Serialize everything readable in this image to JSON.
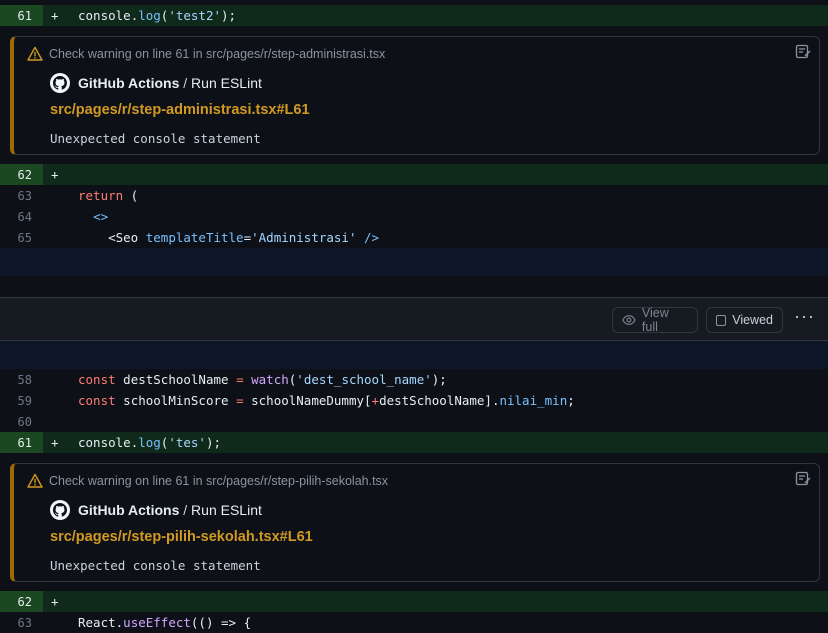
{
  "diff_top": {
    "line_61": {
      "num": "61",
      "marker": "+",
      "code_obj": "console",
      "code_fn": "log",
      "code_str": "'test2'",
      "code_end": ");"
    },
    "line_62": {
      "num": "62",
      "marker": "+"
    },
    "line_63": {
      "num": "63",
      "code_kw": "return",
      "code_rest": " ("
    },
    "line_64": {
      "num": "64",
      "code": "<>"
    },
    "line_65": {
      "num": "65",
      "code_tag": "<Seo",
      "code_attr": "templateTitle",
      "code_eq": "=",
      "code_str": "'Administrasi'",
      "code_close": " />"
    }
  },
  "annotation_1": {
    "title": "Check warning on line 61 in src/pages/r/step-administrasi.tsx",
    "app_name": "GitHub Actions",
    "separator": " / ",
    "job": "Run ESLint",
    "link": "src/pages/r/step-administrasi.tsx#L61",
    "message": "Unexpected console statement"
  },
  "file_header": {
    "view_full_label": "View full",
    "viewed_label": "Viewed"
  },
  "diff_bottom": {
    "line_58": {
      "num": "58",
      "kw": "const",
      "name": " destSchoolName ",
      "eq": "=",
      "sp": " ",
      "fn": "watch",
      "open": "(",
      "str": "'dest_school_name'",
      "end": ");"
    },
    "line_59": {
      "num": "59",
      "kw": "const",
      "name": " schoolMinScore ",
      "eq": "=",
      "rest1": " schoolNameDummy[",
      "op": "+",
      "rest2": "destSchoolName].",
      "prop": "nilai_min",
      "end": ";"
    },
    "line_60": {
      "num": "60"
    },
    "line_61": {
      "num": "61",
      "marker": "+",
      "code_obj": "console",
      "code_fn": "log",
      "code_str": "'tes'",
      "code_end": ");"
    },
    "line_62": {
      "num": "62",
      "marker": "+"
    },
    "line_63": {
      "num": "63",
      "code_obj": "React",
      "code_fn": "useEffect",
      "code_rest": "(() => {"
    }
  },
  "annotation_2": {
    "title": "Check warning on line 61 in src/pages/r/step-pilih-sekolah.tsx",
    "app_name": "GitHub Actions",
    "separator": " / ",
    "job": "Run ESLint",
    "link": "src/pages/r/step-pilih-sekolah.tsx#L61",
    "message": "Unexpected console statement"
  },
  "icons": {
    "warning": "alert-triangle-icon",
    "note": "note-icon",
    "github": "github-mark-icon",
    "eye": "eye-icon",
    "kebab": "kebab-horizontal-icon"
  },
  "colors": {
    "background": "#0d1117",
    "added_line": "#0f2a1a",
    "added_gutter": "#1b4721",
    "warning_accent": "#9e6a03",
    "link": "#d29922"
  }
}
